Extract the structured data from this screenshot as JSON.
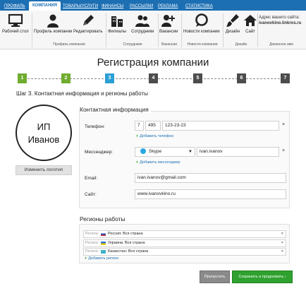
{
  "topnav": {
    "tabs": [
      {
        "label": "ПРОФИЛЬ"
      },
      {
        "label": "КОМПАНИЯ"
      },
      {
        "label": "ТОВАРЫ/УСЛУГИ"
      },
      {
        "label": "ФИНАНСЫ"
      },
      {
        "label": "РАССЫЛКИ"
      },
      {
        "label": "РЕКЛАМА"
      },
      {
        "label": "СТАТИСТИКА"
      }
    ]
  },
  "ribbon": {
    "buttons": [
      {
        "label": "Рабочий стол",
        "icon": "monitor-icon"
      },
      {
        "label": "Профиль компании",
        "icon": "user-icon"
      },
      {
        "label": "Редактировать",
        "icon": "pencil-icon"
      },
      {
        "label": "Филиалы",
        "icon": "buildings-icon"
      },
      {
        "label": "Сотрудники",
        "icon": "users-icon"
      },
      {
        "label": "Вакансии",
        "icon": "add-user-icon"
      },
      {
        "label": "Новости компании",
        "icon": "chat-bubble-icon"
      },
      {
        "label": "Дизайн",
        "icon": "brush-icon"
      },
      {
        "label": "Сайт",
        "icon": "home-icon"
      }
    ],
    "groups": [
      "Профиль компании",
      "Сотрудники",
      "Вакансии",
      "Новости компании",
      "Дизайн"
    ],
    "domain": {
      "label": "Адрес вашего сайта:",
      "value": "ivanovkino.linkros.ru",
      "group": "Доменное имя"
    }
  },
  "page_title": "Регистрация компании",
  "steps": [
    {
      "num": "1",
      "color": "#6fac2f"
    },
    {
      "num": "2",
      "color": "#6fac2f"
    },
    {
      "num": "3",
      "color": "#2b9fd4"
    },
    {
      "num": "4",
      "color": "#4d4d4d"
    },
    {
      "num": "5",
      "color": "#4d4d4d"
    },
    {
      "num": "6",
      "color": "#4d4d4d"
    },
    {
      "num": "7",
      "color": "#4d4d4d"
    }
  ],
  "step_title": "Шаг 3. Контактная информация и регионы работы",
  "logo": {
    "line1": "ИП",
    "line2": "Иванов",
    "change_label": "Изменить логотип"
  },
  "contact": {
    "title": "Контактная информация",
    "phone_label": "Телефон:",
    "phone_country": "7",
    "phone_code": "495",
    "phone_number": "123-23-23",
    "add_phone": "Добавить телефон",
    "messenger_label": "Мессенджер:",
    "messenger_type": "Skype",
    "messenger_value": "ivan.ivanov",
    "add_messenger": "Добавить мессенджер",
    "email_label": "Email:",
    "email_value": "ivan.ivanov@gmail.com",
    "site_label": "Сайт:",
    "site_value": "www.ivanovkino.ru"
  },
  "regions": {
    "title": "Регионы работы",
    "row_label": "Регион:",
    "items": [
      {
        "text": "Россия: Вся страна"
      },
      {
        "text": "Украина: Вся страна"
      },
      {
        "text": "Казахстан: Вся страна"
      }
    ],
    "add_region": "Добавить регион"
  },
  "actions": {
    "skip": "Пропустить",
    "save": "Сохранить и продолжить ›"
  }
}
